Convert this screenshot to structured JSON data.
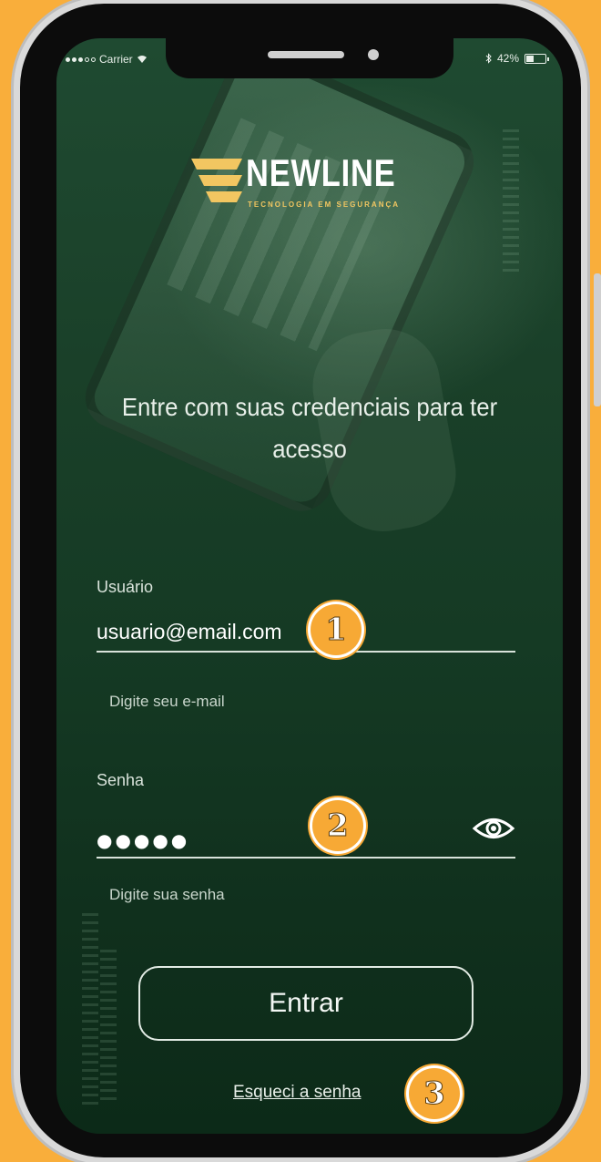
{
  "status_bar": {
    "carrier": "Carrier",
    "battery": "42%",
    "battery_level": 0.42
  },
  "logo": {
    "name": "NEWLINE",
    "tagline": "TECNOLOGIA EM SEGURANÇA",
    "mark_color": "#f2c661"
  },
  "welcome_text": "Entre com suas credenciais para ter acesso",
  "username": {
    "label": "Usuário",
    "value": "usuario@email.com",
    "helper": "Digite seu e-mail"
  },
  "password": {
    "label": "Senha",
    "masked_value": "●●●●●",
    "helper": "Digite sua senha"
  },
  "enter_button": "Entrar",
  "forgot_password_link": "Esqueci a senha",
  "callouts": [
    "1",
    "2",
    "3"
  ],
  "colors": {
    "background": "#f9ae3b",
    "screen": "#1a4029",
    "callout": "#f7a935"
  }
}
